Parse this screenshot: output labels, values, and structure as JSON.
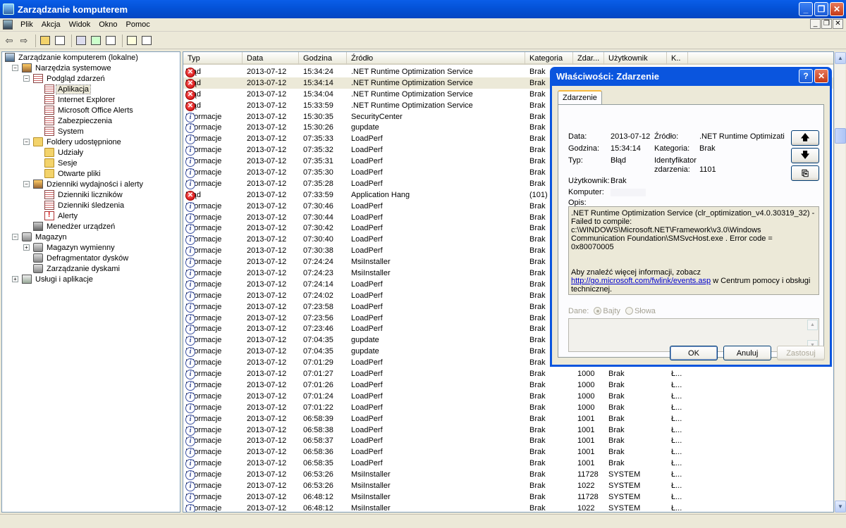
{
  "window": {
    "title": "Zarządzanie komputerem",
    "btn_min": "_",
    "btn_max": "❐",
    "btn_close": "✕"
  },
  "menu": [
    "Plik",
    "Akcja",
    "Widok",
    "Okno",
    "Pomoc"
  ],
  "mdi": {
    "min": "_",
    "restore": "❐",
    "close": "✕"
  },
  "toolbar": {
    "back": "⇦",
    "forward": "⇨"
  },
  "tree": [
    {
      "label": "Zarządzanie komputerem (lokalne)",
      "level": 0,
      "icon": "comp",
      "pm": ""
    },
    {
      "label": "Narzędzia systemowe",
      "level": 1,
      "icon": "tool",
      "pm": "−"
    },
    {
      "label": "Podgląd zdarzeń",
      "level": 2,
      "icon": "log",
      "pm": "−"
    },
    {
      "label": "Aplikacja",
      "level": 3,
      "icon": "log",
      "pm": "",
      "sel": true
    },
    {
      "label": "Internet Explorer",
      "level": 3,
      "icon": "log",
      "pm": ""
    },
    {
      "label": "Microsoft Office Alerts",
      "level": 3,
      "icon": "log",
      "pm": ""
    },
    {
      "label": "Zabezpieczenia",
      "level": 3,
      "icon": "log",
      "pm": ""
    },
    {
      "label": "System",
      "level": 3,
      "icon": "log",
      "pm": ""
    },
    {
      "label": "Foldery udostępnione",
      "level": 2,
      "icon": "folder",
      "pm": "−"
    },
    {
      "label": "Udziały",
      "level": 3,
      "icon": "folder",
      "pm": ""
    },
    {
      "label": "Sesje",
      "level": 3,
      "icon": "folder",
      "pm": ""
    },
    {
      "label": "Otwarte pliki",
      "level": 3,
      "icon": "folder",
      "pm": ""
    },
    {
      "label": "Dzienniki wydajności i alerty",
      "level": 2,
      "icon": "tool",
      "pm": "−"
    },
    {
      "label": "Dzienniki liczników",
      "level": 3,
      "icon": "log",
      "pm": ""
    },
    {
      "label": "Dzienniki śledzenia",
      "level": 3,
      "icon": "log",
      "pm": ""
    },
    {
      "label": "Alerty",
      "level": 3,
      "icon": "alert",
      "pm": ""
    },
    {
      "label": "Menedżer urządzeń",
      "level": 2,
      "icon": "dev",
      "pm": ""
    },
    {
      "label": "Magazyn",
      "level": 1,
      "icon": "disk",
      "pm": "−"
    },
    {
      "label": "Magazyn wymienny",
      "level": 2,
      "icon": "disk",
      "pm": "+"
    },
    {
      "label": "Defragmentator dysków",
      "level": 2,
      "icon": "disk",
      "pm": ""
    },
    {
      "label": "Zarządzanie dyskami",
      "level": 2,
      "icon": "disk",
      "pm": ""
    },
    {
      "label": "Usługi i aplikacje",
      "level": 1,
      "icon": "svc",
      "pm": "+"
    }
  ],
  "list": {
    "columns": [
      {
        "label": "Typ",
        "w": 84
      },
      {
        "label": "Data",
        "w": 80
      },
      {
        "label": "Godzina",
        "w": 68
      },
      {
        "label": "Źródło",
        "w": 253
      },
      {
        "label": "Kategoria",
        "w": 68
      },
      {
        "label": "Zdar...",
        "w": 44
      },
      {
        "label": "Użytkownik",
        "w": 89
      },
      {
        "label": "K..",
        "w": 30
      }
    ],
    "severity_icons": {
      "err": "✕",
      "inf": "i"
    },
    "rows": [
      [
        "err",
        "Błąd",
        "2013-07-12",
        "15:34:24",
        ".NET Runtime Optimization Service",
        "Brak",
        "",
        "",
        ""
      ],
      [
        "err",
        "Błąd",
        "2013-07-12",
        "15:34:14",
        ".NET Runtime Optimization Service",
        "Brak",
        "",
        "",
        ""
      ],
      [
        "err",
        "Błąd",
        "2013-07-12",
        "15:34:04",
        ".NET Runtime Optimization Service",
        "Brak",
        "",
        "",
        ""
      ],
      [
        "err",
        "Błąd",
        "2013-07-12",
        "15:33:59",
        ".NET Runtime Optimization Service",
        "Brak",
        "",
        "",
        ""
      ],
      [
        "inf",
        "Informacje",
        "2013-07-12",
        "15:30:35",
        "SecurityCenter",
        "Brak",
        "",
        "",
        ""
      ],
      [
        "inf",
        "Informacje",
        "2013-07-12",
        "15:30:26",
        "gupdate",
        "Brak",
        "",
        "",
        ""
      ],
      [
        "inf",
        "Informacje",
        "2013-07-12",
        "07:35:33",
        "LoadPerf",
        "Brak",
        "",
        "",
        ""
      ],
      [
        "inf",
        "Informacje",
        "2013-07-12",
        "07:35:32",
        "LoadPerf",
        "Brak",
        "",
        "",
        ""
      ],
      [
        "inf",
        "Informacje",
        "2013-07-12",
        "07:35:31",
        "LoadPerf",
        "Brak",
        "",
        "",
        ""
      ],
      [
        "inf",
        "Informacje",
        "2013-07-12",
        "07:35:30",
        "LoadPerf",
        "Brak",
        "",
        "",
        ""
      ],
      [
        "inf",
        "Informacje",
        "2013-07-12",
        "07:35:28",
        "LoadPerf",
        "Brak",
        "",
        "",
        ""
      ],
      [
        "err",
        "Błąd",
        "2013-07-12",
        "07:33:59",
        "Application Hang",
        "(101)",
        "",
        "",
        ""
      ],
      [
        "inf",
        "Informacje",
        "2013-07-12",
        "07:30:46",
        "LoadPerf",
        "Brak",
        "",
        "",
        ""
      ],
      [
        "inf",
        "Informacje",
        "2013-07-12",
        "07:30:44",
        "LoadPerf",
        "Brak",
        "",
        "",
        ""
      ],
      [
        "inf",
        "Informacje",
        "2013-07-12",
        "07:30:42",
        "LoadPerf",
        "Brak",
        "",
        "",
        ""
      ],
      [
        "inf",
        "Informacje",
        "2013-07-12",
        "07:30:40",
        "LoadPerf",
        "Brak",
        "",
        "",
        ""
      ],
      [
        "inf",
        "Informacje",
        "2013-07-12",
        "07:30:38",
        "LoadPerf",
        "Brak",
        "",
        "",
        ""
      ],
      [
        "inf",
        "Informacje",
        "2013-07-12",
        "07:24:24",
        "MsiInstaller",
        "Brak",
        "",
        "",
        ""
      ],
      [
        "inf",
        "Informacje",
        "2013-07-12",
        "07:24:23",
        "MsiInstaller",
        "Brak",
        "",
        "",
        ""
      ],
      [
        "inf",
        "Informacje",
        "2013-07-12",
        "07:24:14",
        "LoadPerf",
        "Brak",
        "",
        "",
        ""
      ],
      [
        "inf",
        "Informacje",
        "2013-07-12",
        "07:24:02",
        "LoadPerf",
        "Brak",
        "",
        "",
        ""
      ],
      [
        "inf",
        "Informacje",
        "2013-07-12",
        "07:23:58",
        "LoadPerf",
        "Brak",
        "",
        "",
        ""
      ],
      [
        "inf",
        "Informacje",
        "2013-07-12",
        "07:23:56",
        "LoadPerf",
        "Brak",
        "",
        "",
        ""
      ],
      [
        "inf",
        "Informacje",
        "2013-07-12",
        "07:23:46",
        "LoadPerf",
        "Brak",
        "",
        "",
        ""
      ],
      [
        "inf",
        "Informacje",
        "2013-07-12",
        "07:04:35",
        "gupdate",
        "Brak",
        "",
        "",
        ""
      ],
      [
        "inf",
        "Informacje",
        "2013-07-12",
        "07:04:35",
        "gupdate",
        "Brak",
        "",
        "",
        ""
      ],
      [
        "inf",
        "Informacje",
        "2013-07-12",
        "07:01:29",
        "LoadPerf",
        "Brak",
        "",
        "",
        ""
      ],
      [
        "inf",
        "Informacje",
        "2013-07-12",
        "07:01:27",
        "LoadPerf",
        "Brak",
        "1000",
        "Brak",
        "Ł..."
      ],
      [
        "inf",
        "Informacje",
        "2013-07-12",
        "07:01:26",
        "LoadPerf",
        "Brak",
        "1000",
        "Brak",
        "Ł..."
      ],
      [
        "inf",
        "Informacje",
        "2013-07-12",
        "07:01:24",
        "LoadPerf",
        "Brak",
        "1000",
        "Brak",
        "Ł..."
      ],
      [
        "inf",
        "Informacje",
        "2013-07-12",
        "07:01:22",
        "LoadPerf",
        "Brak",
        "1000",
        "Brak",
        "Ł..."
      ],
      [
        "inf",
        "Informacje",
        "2013-07-12",
        "06:58:39",
        "LoadPerf",
        "Brak",
        "1001",
        "Brak",
        "Ł..."
      ],
      [
        "inf",
        "Informacje",
        "2013-07-12",
        "06:58:38",
        "LoadPerf",
        "Brak",
        "1001",
        "Brak",
        "Ł..."
      ],
      [
        "inf",
        "Informacje",
        "2013-07-12",
        "06:58:37",
        "LoadPerf",
        "Brak",
        "1001",
        "Brak",
        "Ł..."
      ],
      [
        "inf",
        "Informacje",
        "2013-07-12",
        "06:58:36",
        "LoadPerf",
        "Brak",
        "1001",
        "Brak",
        "Ł..."
      ],
      [
        "inf",
        "Informacje",
        "2013-07-12",
        "06:58:35",
        "LoadPerf",
        "Brak",
        "1001",
        "Brak",
        "Ł..."
      ],
      [
        "inf",
        "Informacje",
        "2013-07-12",
        "06:53:26",
        "MsiInstaller",
        "Brak",
        "11728",
        "SYSTEM",
        "Ł..."
      ],
      [
        "inf",
        "Informacje",
        "2013-07-12",
        "06:53:26",
        "MsiInstaller",
        "Brak",
        "1022",
        "SYSTEM",
        "Ł..."
      ],
      [
        "inf",
        "Informacje",
        "2013-07-12",
        "06:48:12",
        "MsiInstaller",
        "Brak",
        "11728",
        "SYSTEM",
        "Ł..."
      ],
      [
        "inf",
        "Informacje",
        "2013-07-12",
        "06:48:12",
        "MsiInstaller",
        "Brak",
        "1022",
        "SYSTEM",
        "Ł..."
      ]
    ]
  },
  "scroll": {
    "up": "▲",
    "down": "▼"
  },
  "dialog": {
    "title": "Właściwości: Zdarzenie",
    "help": "?",
    "close": "✕",
    "tab": "Zdarzenie",
    "data_label": "Data:",
    "data": "2013-07-12",
    "zrodlo_label": "Źródło:",
    "zrodlo": ".NET Runtime Optimizati",
    "godzina_label": "Godzina:",
    "godzina": "15:34:14",
    "kategoria_label": "Kategoria:",
    "kategoria": "Brak",
    "typ_label": "Typ:",
    "typ": "Błąd",
    "id_label1": "Identyfikator",
    "id_label2": "zdarzenia:",
    "id": "1101",
    "user_label": "Użytkownik:",
    "user": "Brak",
    "komputer_label": "Komputer:",
    "opis_label": "Opis:",
    "desc1": ".NET Runtime Optimization Service (clr_optimization_v4.0.30319_32) - Failed to compile: c:\\WINDOWS\\Microsoft.NET\\Framework\\v3.0\\Windows Communication Foundation\\SMSvcHost.exe . Error code = 0x80070005",
    "desc2_pre": "Aby znaleźć więcej informacji, zobacz",
    "desc_link": "http://go.microsoft.com/fwlink/events.asp",
    "desc2_post": " w Centrum pomocy i obsługi technicznej.",
    "dane_label": "Dane:",
    "bajty": "Bajty",
    "slowa": "Słowa",
    "up": "🡅",
    "down": "🡇",
    "copy": "⎘",
    "ok": "OK",
    "cancel": "Anuluj",
    "apply": "Zastosuj"
  }
}
